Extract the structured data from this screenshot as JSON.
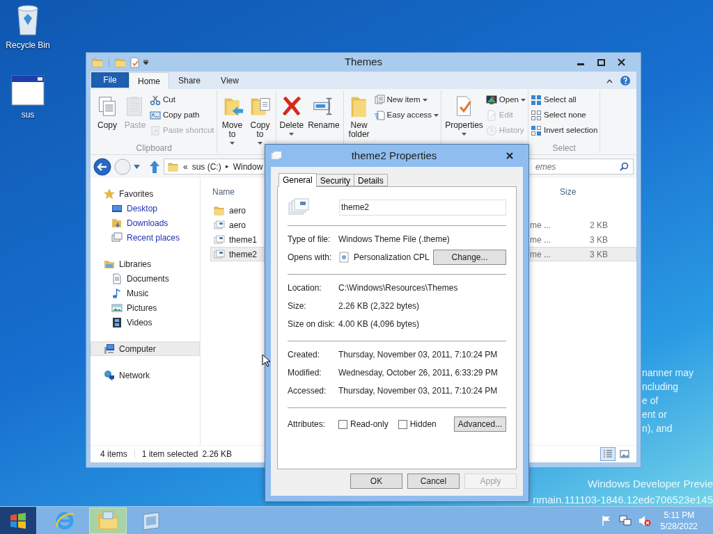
{
  "desktop": {
    "icons": [
      {
        "label": "Recycle Bin",
        "kind": "recycle"
      },
      {
        "label": "sus",
        "kind": "window"
      }
    ],
    "notice_lines": [
      "nanner may",
      "ncluding",
      "e of",
      "ent or",
      "n), and"
    ],
    "build_lines": [
      "Windows Developer Previe",
      "nmain.111103-1846.12edc706523e145"
    ]
  },
  "explorer": {
    "title": "Themes",
    "ribbon_tabs": [
      {
        "label": "File",
        "kind": "file",
        "selected": false
      },
      {
        "label": "Home",
        "kind": "tab",
        "selected": true
      },
      {
        "label": "Share",
        "kind": "tab",
        "selected": false
      },
      {
        "label": "View",
        "kind": "tab",
        "selected": false
      }
    ],
    "ribbon_groups": [
      {
        "label": "Clipboard",
        "items": [
          {
            "label": "Copy",
            "kind": "copy",
            "disabled": false,
            "dropdown": false
          },
          {
            "label": "Paste",
            "kind": "paste",
            "disabled": true,
            "dropdown": false
          },
          {
            "label": "Cut",
            "kind": "cut",
            "disabled": false,
            "dropdown": false
          },
          {
            "label": "Copy path",
            "kind": "copy_path",
            "disabled": false,
            "dropdown": false
          },
          {
            "label": "Paste shortcut",
            "kind": "paste_shortcut",
            "disabled": true,
            "dropdown": false
          }
        ]
      },
      {
        "items": [
          {
            "label": "Move to",
            "kind": "move_to",
            "disabled": false,
            "dropdown": true
          },
          {
            "label": "Copy to",
            "kind": "copy_to",
            "disabled": false,
            "dropdown": true
          }
        ]
      },
      {
        "items": [
          {
            "label": "Delete",
            "kind": "delete",
            "disabled": false,
            "dropdown": true
          },
          {
            "label": "Rename",
            "kind": "rename",
            "disabled": false,
            "dropdown": false
          }
        ]
      },
      {
        "items": [
          {
            "label": "New folder",
            "kind": "new_folder",
            "disabled": false,
            "dropdown": false
          },
          {
            "label": "New item",
            "kind": "new_item",
            "disabled": false,
            "dropdown": true
          },
          {
            "label": "Easy access",
            "kind": "easy_access",
            "disabled": false,
            "dropdown": true
          }
        ]
      },
      {
        "items": [
          {
            "label": "Properties",
            "kind": "properties",
            "disabled": false,
            "dropdown": true
          },
          {
            "label": "Open",
            "kind": "open",
            "disabled": false,
            "dropdown": true
          },
          {
            "label": "Edit",
            "kind": "edit",
            "disabled": true,
            "dropdown": false
          },
          {
            "label": "History",
            "kind": "history",
            "disabled": true,
            "dropdown": false
          }
        ]
      },
      {
        "label": "Select",
        "items": [
          {
            "label": "Select all",
            "kind": "select_all",
            "disabled": false,
            "dropdown": false
          },
          {
            "label": "Select none",
            "kind": "select_none",
            "disabled": false,
            "dropdown": false
          },
          {
            "label": "Invert selection",
            "kind": "invert",
            "disabled": false,
            "dropdown": false
          }
        ]
      }
    ],
    "address": {
      "overflow": "«",
      "drive": "sus (C:)",
      "separator": "▸",
      "folder": "Window"
    },
    "search": {
      "placeholder": "emes"
    },
    "nav": [
      {
        "label": "Favorites",
        "kind": "star",
        "selected": false,
        "color": "#1e1e1e",
        "children": [
          {
            "label": "Desktop",
            "kind": "desktop",
            "selected": false,
            "color": "#1e32b4"
          },
          {
            "label": "Downloads",
            "kind": "downloads",
            "selected": false,
            "color": "#1e32b4"
          },
          {
            "label": "Recent places",
            "kind": "recent",
            "selected": false,
            "color": "#1e32b4"
          }
        ]
      },
      {
        "label": "Libraries",
        "kind": "libraries",
        "selected": false,
        "color": "#1e1e1e",
        "children": [
          {
            "label": "Documents",
            "kind": "documents",
            "selected": false,
            "color": "#1e1e1e"
          },
          {
            "label": "Music",
            "kind": "music",
            "selected": false,
            "color": "#1e1e1e"
          },
          {
            "label": "Pictures",
            "kind": "pictures",
            "selected": false,
            "color": "#1e1e1e"
          },
          {
            "label": "Videos",
            "kind": "videos",
            "selected": false,
            "color": "#1e1e1e"
          }
        ]
      },
      {
        "label": "Computer",
        "kind": "computer",
        "selected": true,
        "color": "#1e1e1e"
      },
      {
        "label": "Network",
        "kind": "network",
        "selected": false,
        "color": "#1e1e1e"
      }
    ],
    "columns": {
      "name": "Name",
      "size": "Size"
    },
    "files": [
      {
        "name": "aero",
        "kind": "folder",
        "selected": false
      },
      {
        "name": "aero",
        "kind": "theme",
        "type": "me ...",
        "size": "2 KB",
        "selected": false
      },
      {
        "name": "theme1",
        "kind": "theme",
        "type": "me ...",
        "size": "3 KB",
        "selected": false
      },
      {
        "name": "theme2",
        "kind": "theme",
        "type": "me ...",
        "size": "3 KB",
        "selected": true
      }
    ],
    "status": {
      "count": "4 items",
      "selection": "1 item selected",
      "size": "2.26 KB"
    },
    "views": [
      {
        "kind": "details",
        "selected": true
      },
      {
        "kind": "large",
        "selected": false
      }
    ]
  },
  "dialog": {
    "title": "theme2 Properties",
    "tabs": [
      {
        "label": "General",
        "selected": true
      },
      {
        "label": "Security",
        "selected": false
      },
      {
        "label": "Details",
        "selected": false
      }
    ],
    "name": "theme2",
    "sections": [
      [
        {
          "label": "Type of file:",
          "value": "Windows Theme File (.theme)",
          "kind": "text"
        },
        {
          "label": "Opens with:",
          "value": "Personalization CPL",
          "kind": "app",
          "button": "Change..."
        }
      ],
      [
        {
          "label": "Location:",
          "value": "C:\\Windows\\Resources\\Themes",
          "kind": "text"
        },
        {
          "label": "Size:",
          "value": "2.26 KB (2,322 bytes)",
          "kind": "text"
        },
        {
          "label": "Size on disk:",
          "value": "4.00 KB (4,096 bytes)",
          "kind": "text"
        }
      ],
      [
        {
          "label": "Created:",
          "value": "Thursday, November 03, 2011, 7:10:24 PM",
          "kind": "text"
        },
        {
          "label": "Modified:",
          "value": "Wednesday, October 26, 2011, 6:33:29 PM",
          "kind": "text"
        },
        {
          "label": "Accessed:",
          "value": "Thursday, November 03, 2011, 7:10:24 PM",
          "kind": "text"
        }
      ]
    ],
    "attributes": {
      "label": "Attributes:",
      "checkboxes": [
        {
          "label": "Read-only",
          "checked": false
        },
        {
          "label": "Hidden",
          "checked": false
        }
      ],
      "button": "Advanced..."
    },
    "buttons": [
      {
        "label": "OK",
        "disabled": false
      },
      {
        "label": "Cancel",
        "disabled": false
      },
      {
        "label": "Apply",
        "disabled": true
      }
    ]
  },
  "taskbar": {
    "apps": [
      {
        "kind": "ie",
        "selected": false
      },
      {
        "kind": "explorer",
        "selected": true
      },
      {
        "kind": "app",
        "selected": false
      }
    ],
    "time": "5:11 PM",
    "date": "5/28/2022"
  }
}
